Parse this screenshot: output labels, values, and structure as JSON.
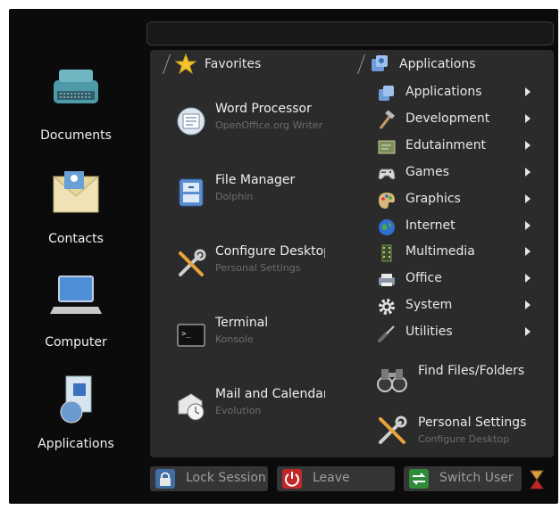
{
  "search": {
    "value": "",
    "placeholder": ""
  },
  "sidebar": {
    "items": [
      {
        "label": "Documents",
        "icon": "typewriter-icon"
      },
      {
        "label": "Contacts",
        "icon": "contacts-envelope-icon"
      },
      {
        "label": "Computer",
        "icon": "laptop-icon"
      },
      {
        "label": "Applications",
        "icon": "applications-box-icon"
      }
    ]
  },
  "favorites": {
    "header": "Favorites",
    "items": [
      {
        "name": "Word Processor",
        "desc": "OpenOffice.org Writer",
        "icon": "word-processor-icon"
      },
      {
        "name": "File Manager",
        "desc": "Dolphin",
        "icon": "file-manager-icon"
      },
      {
        "name": "Configure Desktop",
        "desc": "Personal Settings",
        "icon": "configure-tools-icon"
      },
      {
        "name": "Terminal",
        "desc": "Konsole",
        "icon": "terminal-icon"
      },
      {
        "name": "Mail and Calendar",
        "desc": "Evolution",
        "icon": "mail-calendar-icon"
      }
    ]
  },
  "applications": {
    "header": "Applications",
    "items": [
      {
        "name": "Applications",
        "icon": "applications-icon"
      },
      {
        "name": "Development",
        "icon": "hammer-icon"
      },
      {
        "name": "Edutainment",
        "icon": "edutainment-icon"
      },
      {
        "name": "Games",
        "icon": "gamepad-icon"
      },
      {
        "name": "Graphics",
        "icon": "palette-icon"
      },
      {
        "name": "Internet",
        "icon": "globe-icon"
      },
      {
        "name": "Multimedia",
        "icon": "film-icon"
      },
      {
        "name": "Office",
        "icon": "printer-icon"
      },
      {
        "name": "System",
        "icon": "gear-icon"
      },
      {
        "name": "Utilities",
        "icon": "screwdriver-icon"
      }
    ],
    "find": {
      "name": "Find Files/Folders",
      "icon": "binoculars-icon"
    },
    "settings": {
      "name": "Personal Settings",
      "desc": "Configure Desktop",
      "icon": "settings-tools-icon"
    }
  },
  "footer": {
    "lock": "Lock Session",
    "leave": "Leave",
    "switch": "Switch User"
  },
  "colors": {
    "background": "#0b0b0b",
    "panel": "#2b2b2b",
    "button": "#353535",
    "leave_red": "#c0282a",
    "switch_green": "#2e8b3a",
    "lock_blue": "#3f6ea5"
  }
}
